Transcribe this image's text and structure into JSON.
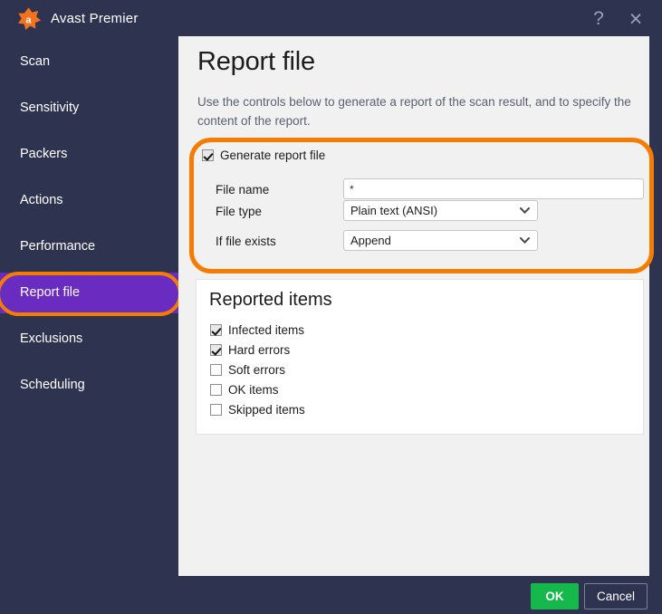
{
  "window": {
    "title": "Avast Premier",
    "logo_icon": "avast-splat-logo",
    "help_icon": "question-mark-icon",
    "help_glyph": "?",
    "close_icon": "close-x-icon",
    "close_glyph": "×",
    "colors": {
      "chrome": "#2e3450",
      "panel": "#f1f1f1",
      "accent_orange": "#f57c00",
      "selected_purple": "#6a2cc0",
      "ok_green": "#14b84b"
    }
  },
  "sidebar": {
    "items": [
      {
        "label": "Scan",
        "selected": false
      },
      {
        "label": "Sensitivity",
        "selected": false
      },
      {
        "label": "Packers",
        "selected": false
      },
      {
        "label": "Actions",
        "selected": false
      },
      {
        "label": "Performance",
        "selected": false
      },
      {
        "label": "Report file",
        "selected": true
      },
      {
        "label": "Exclusions",
        "selected": false
      },
      {
        "label": "Scheduling",
        "selected": false
      }
    ]
  },
  "main": {
    "title": "Report file",
    "description": "Use the controls below to generate a report of the scan result, and to specify the content of the report.",
    "generate": {
      "checkbox_label": "Generate report file",
      "checked": true,
      "fields": [
        {
          "label": "File name",
          "type": "text",
          "value": "*",
          "placeholder": ""
        },
        {
          "label": "File type",
          "type": "select",
          "value": "Plain text (ANSI)",
          "chevron_icon": "chevron-down-icon"
        },
        {
          "label": "If file exists",
          "type": "select",
          "value": "Append",
          "chevron_icon": "chevron-down-icon"
        }
      ]
    },
    "reported": {
      "title": "Reported items",
      "items": [
        {
          "label": "Infected items",
          "checked": true
        },
        {
          "label": "Hard errors",
          "checked": true
        },
        {
          "label": "Soft errors",
          "checked": false
        },
        {
          "label": "OK items",
          "checked": false
        },
        {
          "label": "Skipped items",
          "checked": false
        }
      ]
    }
  },
  "footer": {
    "ok_label": "OK",
    "cancel_label": "Cancel"
  }
}
